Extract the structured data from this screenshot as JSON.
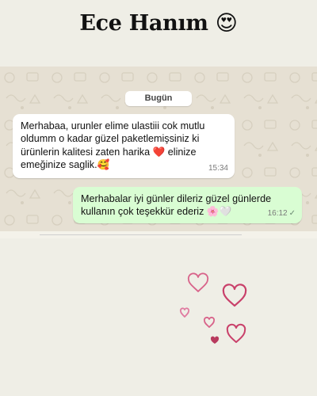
{
  "header": {
    "title": "Ece Hanım",
    "emoji": "😍"
  },
  "chat": {
    "date_label": "Bugün",
    "messages": [
      {
        "direction": "incoming",
        "text": "Merhabaa, urunler elime ulastiii cok mutlu oldumm o kadar güzel paketlemişsiniz ki ürünlerin kalitesi zaten harika ❤️ elinize emeğinize saglik.🥰",
        "time": "15:34"
      },
      {
        "direction": "outgoing",
        "text": "Merhabalar iyi günler dileriz güzel günlerde kullanın çok teşekkür ederiz 🌸🤍",
        "time": "16:12",
        "status_icon": "single-check-icon"
      }
    ]
  },
  "colors": {
    "background": "#efeee6",
    "chat_wallpaper": "#e6e0d3",
    "incoming_bubble": "#ffffff",
    "outgoing_bubble": "#d9fdd3",
    "heart": "#c9406a"
  }
}
